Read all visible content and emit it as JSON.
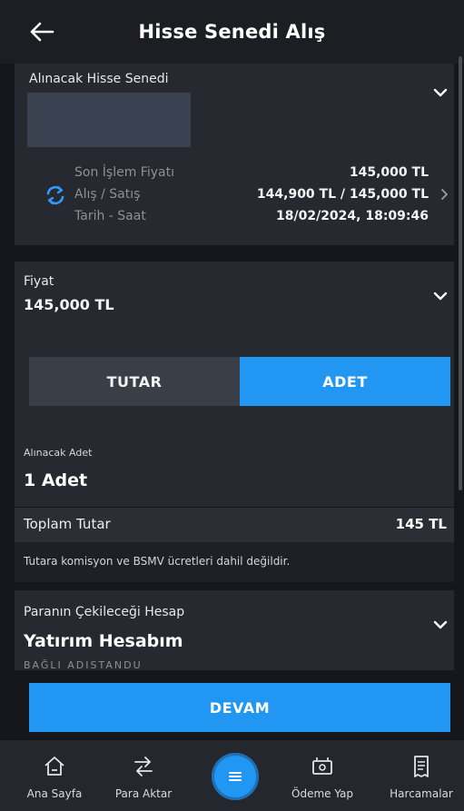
{
  "header": {
    "title": "Hisse Senedi Alış"
  },
  "stock": {
    "label": "Alınacak Hisse Senedi"
  },
  "price_info": {
    "rows": [
      {
        "label": "Son İşlem Fiyatı",
        "value": "145,000 TL"
      },
      {
        "label": "Alış / Satış",
        "value": "144,900 TL / 145,000 TL"
      },
      {
        "label": "Tarih - Saat",
        "value": "18/02/2024, 18:09:46"
      }
    ]
  },
  "price": {
    "label": "Fiyat",
    "value": "145,000 TL"
  },
  "toggle": {
    "left_label": "TUTAR",
    "right_label": "ADET",
    "selected": "ADET"
  },
  "quantity": {
    "label": "Alınacak Adet",
    "value": "1 Adet"
  },
  "total": {
    "label": "Toplam Tutar",
    "value": "145 TL"
  },
  "note": "Tutara komisyon ve BSMV ücretleri dahil değildir.",
  "account": {
    "label": "Paranın Çekileceği Hesap",
    "value": "Yatırım Hesabım",
    "sub": "BAĞLI ADISTANDU"
  },
  "continue_label": "DEVAM",
  "nav": {
    "items": [
      {
        "label": "Ana Sayfa",
        "icon": "home-icon"
      },
      {
        "label": "Para Aktar",
        "icon": "transfer-icon"
      },
      {
        "label": "Ödeme Yap",
        "icon": "payment-icon"
      },
      {
        "label": "Harcamalar",
        "icon": "receipt-icon"
      }
    ]
  },
  "colors": {
    "accent": "#2196f3",
    "background": "#15171c",
    "panel": "#26292f"
  }
}
